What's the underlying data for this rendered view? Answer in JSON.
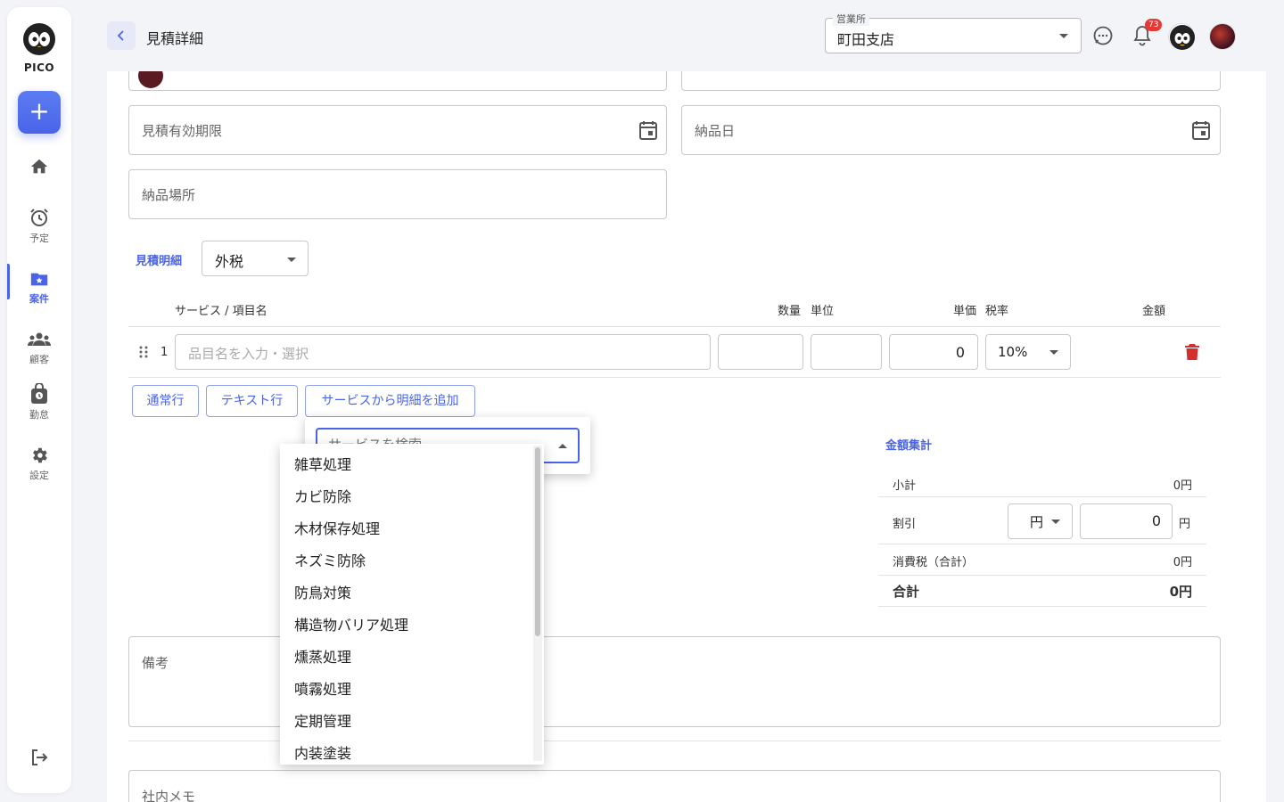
{
  "app": {
    "logo_text": "PICO"
  },
  "sidebar": {
    "items": [
      {
        "label": ""
      },
      {
        "label": "予定"
      },
      {
        "label": "案件"
      },
      {
        "label": "顧客"
      },
      {
        "label": "勤怠"
      },
      {
        "label": "設定"
      }
    ]
  },
  "header": {
    "title": "見積詳細",
    "branch_label": "営業所",
    "branch_value": "町田支店",
    "notification_count": "73"
  },
  "form": {
    "expiry_label": "見積有効期限",
    "delivery_date_label": "納品日",
    "delivery_place_label": "納品場所",
    "remarks_label": "備考",
    "internal_memo_label": "社内メモ"
  },
  "details": {
    "section_title": "見積明細",
    "tax_mode": "外税",
    "columns": {
      "service": "サービス / 項目名",
      "qty": "数量",
      "unit": "単位",
      "price": "単価",
      "tax_rate": "税率",
      "amount": "金額"
    },
    "row": {
      "number": "1",
      "item_placeholder": "品目名を入力・選択",
      "price": "0",
      "tax_rate": "10%"
    },
    "buttons": {
      "normal_row": "通常行",
      "text_row": "テキスト行",
      "add_from_service": "サービスから明細を追加"
    }
  },
  "totals": {
    "title": "金額集計",
    "subtotal_label": "小計",
    "subtotal_value": "0円",
    "discount_label": "割引",
    "discount_unit": "円",
    "discount_value": "0",
    "discount_suffix": "円",
    "tax_label": "消費税（合計）",
    "tax_value": "0円",
    "total_label": "合計",
    "total_value": "0円"
  },
  "service_dropdown": {
    "search_placeholder": "サービスを検索",
    "options": [
      "雑草処理",
      "カビ防除",
      "木材保存処理",
      "ネズミ防除",
      "防鳥対策",
      "構造物バリア処理",
      "燻蒸処理",
      "噴霧処理",
      "定期管理",
      "内装塗装"
    ]
  },
  "colors": {
    "accent": "#4a63e8",
    "delete": "#d32f2f",
    "badge": "#e53935"
  }
}
